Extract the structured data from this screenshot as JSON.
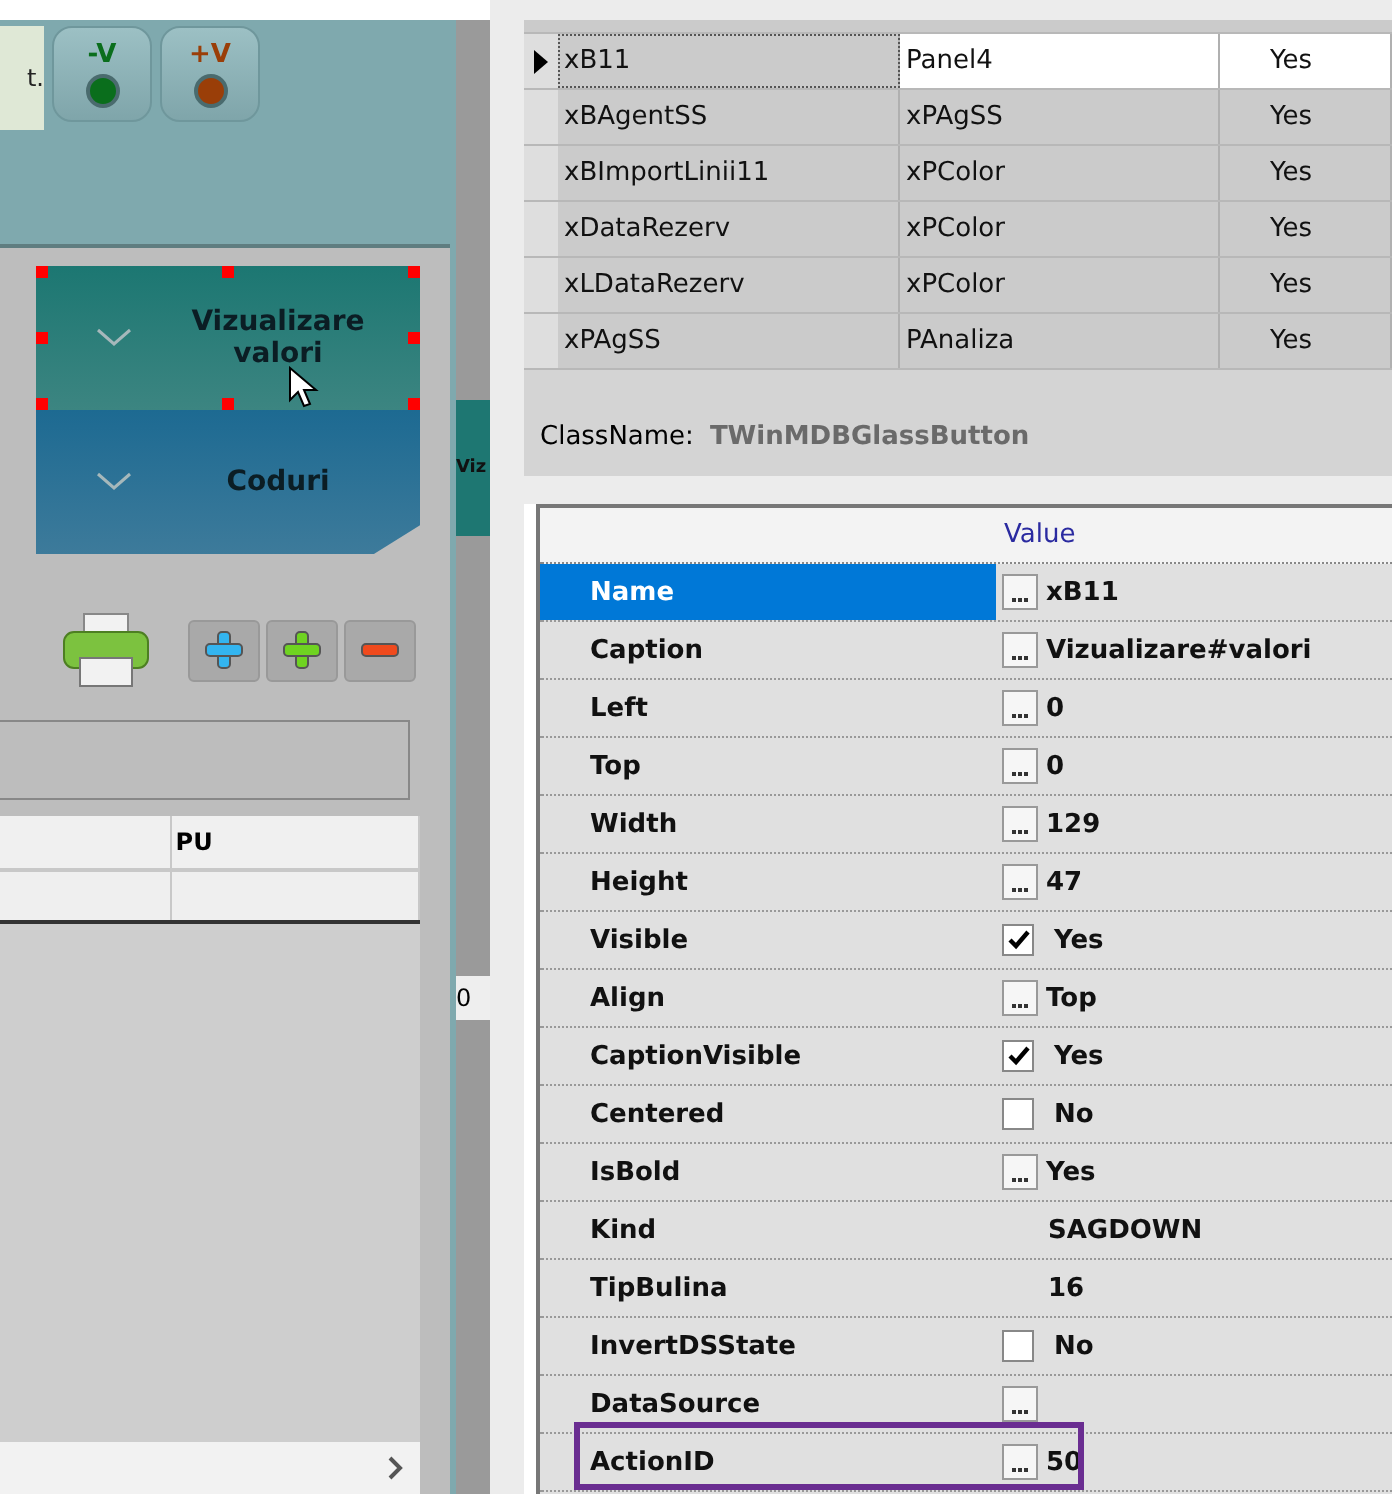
{
  "left_panel": {
    "status_text": "t.",
    "voltage_buttons": [
      {
        "label": "-V",
        "color": "#0a6e1c"
      },
      {
        "label": "+V",
        "color": "#9a3e08"
      }
    ],
    "glass_buttons": [
      {
        "label": "Vizualizare valori",
        "selected": true,
        "color": "#1c7772"
      },
      {
        "label": "Coduri",
        "selected": false,
        "color": "#1d6a92"
      }
    ],
    "table": {
      "columns": [
        "PU"
      ]
    }
  },
  "middle_strip": {
    "fragments": [
      "Viz",
      "0"
    ]
  },
  "components_grid": {
    "rows": [
      {
        "name": "xB11",
        "parent": "Panel4",
        "visible": "Yes",
        "selected": true
      },
      {
        "name": "xBAgentSS",
        "parent": "xPAgSS",
        "visible": "Yes",
        "selected": false
      },
      {
        "name": "xBImportLinii11",
        "parent": "xPColor",
        "visible": "Yes",
        "selected": false
      },
      {
        "name": "xDataRezerv",
        "parent": "xPColor",
        "visible": "Yes",
        "selected": false
      },
      {
        "name": "xLDataRezerv",
        "parent": "xPColor",
        "visible": "Yes",
        "selected": false
      },
      {
        "name": "xPAgSS",
        "parent": "PAnaliza",
        "visible": "Yes",
        "selected": false
      }
    ],
    "class_name": {
      "label": "ClassName:",
      "value": "TWinMDBGlassButton"
    }
  },
  "inspector": {
    "header": "Value",
    "properties": [
      {
        "name": "Name",
        "kind": "button",
        "value": "xB11",
        "selected": true,
        "highlighted": false
      },
      {
        "name": "Caption",
        "kind": "button",
        "value": "Vizualizare#valori",
        "selected": false,
        "highlighted": false
      },
      {
        "name": "Left",
        "kind": "button",
        "value": "0",
        "selected": false,
        "highlighted": false
      },
      {
        "name": "Top",
        "kind": "button",
        "value": "0",
        "selected": false,
        "highlighted": false
      },
      {
        "name": "Width",
        "kind": "button",
        "value": "129",
        "selected": false,
        "highlighted": false
      },
      {
        "name": "Height",
        "kind": "button",
        "value": "47",
        "selected": false,
        "highlighted": false
      },
      {
        "name": "Visible",
        "kind": "check",
        "checked": true,
        "value": "Yes",
        "selected": false,
        "highlighted": false
      },
      {
        "name": "Align",
        "kind": "button",
        "value": "Top",
        "selected": false,
        "highlighted": false
      },
      {
        "name": "CaptionVisible",
        "kind": "check",
        "checked": true,
        "value": "Yes",
        "selected": false,
        "highlighted": false
      },
      {
        "name": "Centered",
        "kind": "check",
        "checked": false,
        "value": "No",
        "selected": false,
        "highlighted": false
      },
      {
        "name": "IsBold",
        "kind": "button",
        "value": "Yes",
        "selected": false,
        "highlighted": false
      },
      {
        "name": "Kind",
        "kind": "plain",
        "value": "SAGDOWN",
        "selected": false,
        "highlighted": false
      },
      {
        "name": "TipBulina",
        "kind": "plain",
        "value": "16",
        "selected": false,
        "highlighted": false
      },
      {
        "name": "InvertDSState",
        "kind": "check",
        "checked": false,
        "value": "No",
        "selected": false,
        "highlighted": false
      },
      {
        "name": "DataSource",
        "kind": "button",
        "selected": false,
        "highlighted": false
      },
      {
        "name": "ActionID",
        "kind": "button",
        "value": "50",
        "selected": false,
        "highlighted": true
      }
    ]
  }
}
